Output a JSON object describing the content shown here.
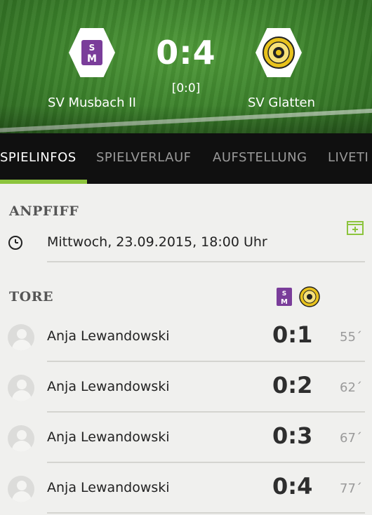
{
  "match": {
    "home_team": "SV Musbach II",
    "away_team": "SV Glatten",
    "score": "0:4",
    "halftime": "[0:0]"
  },
  "tabs": [
    {
      "label": "SPIELINFOS",
      "active": true
    },
    {
      "label": "SPIELVERLAUF",
      "active": false
    },
    {
      "label": "AUFSTELLUNG",
      "active": false
    },
    {
      "label": "LIVETI",
      "active": false
    }
  ],
  "kickoff": {
    "title": "ANPFIFF",
    "datetime": "Mittwoch, 23.09.2015, 18:00 Uhr"
  },
  "goals": {
    "title": "TORE",
    "items": [
      {
        "player": "Anja Lewandowski",
        "score": "0:1",
        "minute": "55´"
      },
      {
        "player": "Anja Lewandowski",
        "score": "0:2",
        "minute": "62´"
      },
      {
        "player": "Anja Lewandowski",
        "score": "0:3",
        "minute": "67´"
      },
      {
        "player": "Anja Lewandowski",
        "score": "0:4",
        "minute": "77´"
      }
    ]
  },
  "colors": {
    "accent": "#8cc43d",
    "home_crest": "#7a3d9a",
    "away_crest": "#e8c21c"
  },
  "icons": {
    "kickoff": "clock-icon",
    "calendar": "calendar-add-icon",
    "player": "avatar-placeholder-icon"
  }
}
